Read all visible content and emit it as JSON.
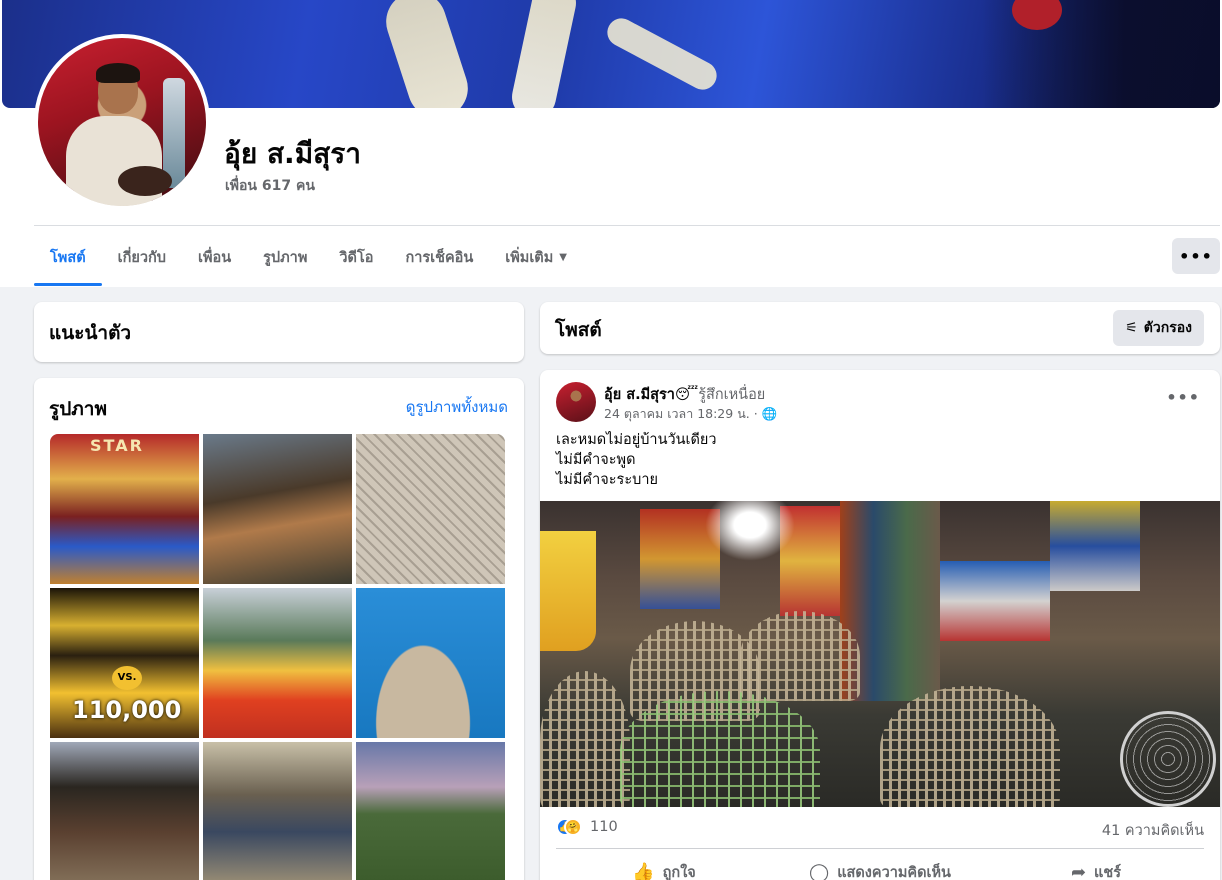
{
  "profile": {
    "name": "อุ้ย ส.มีสุรา",
    "friends": "เพื่อน 617 คน"
  },
  "tabs": [
    {
      "label": "โพสต์",
      "active": true
    },
    {
      "label": "เกี่ยวกับ",
      "active": false
    },
    {
      "label": "เพื่อน",
      "active": false
    },
    {
      "label": "รูปภาพ",
      "active": false
    },
    {
      "label": "วิดีโอ",
      "active": false
    },
    {
      "label": "การเช็คอิน",
      "active": false
    },
    {
      "label": "เพิ่มเติม",
      "active": false
    }
  ],
  "more_button_label": "•••",
  "intro": {
    "title": "แนะนำตัว"
  },
  "photos": {
    "title": "รูปภาพ",
    "see_all": "ดูรูปภาพทั้งหมด",
    "tile1_text": "STAR",
    "tile4_vs": "VS.",
    "tile4_amount": "110,000"
  },
  "posts_section": {
    "title": "โพสต์",
    "filter_label": "ตัวกรอง",
    "filter_icon": "sliders-icon"
  },
  "post": {
    "author": "อุ้ย ส.มีสุรา",
    "emoji": "😴",
    "feeling": "รู้สึกเหนื่อย",
    "timestamp": "24 ตุลาคม เวลา 18:29 น.",
    "privacy_icon": "globe-icon",
    "lines": [
      "เละหมดไม่อยู่บ้านวันเดียว",
      "ไม่มีคำจะพูด",
      "ไม่มีคำจะระบาย"
    ],
    "reaction_count": "110",
    "comment_count": "41 ความคิดเห็น",
    "actions": {
      "like": "ถูกใจ",
      "comment": "แสดงความคิดเห็น",
      "share": "แชร์"
    }
  },
  "colors": {
    "accent": "#1877f2",
    "background": "#f0f2f5",
    "secondary_text": "#65676b"
  }
}
